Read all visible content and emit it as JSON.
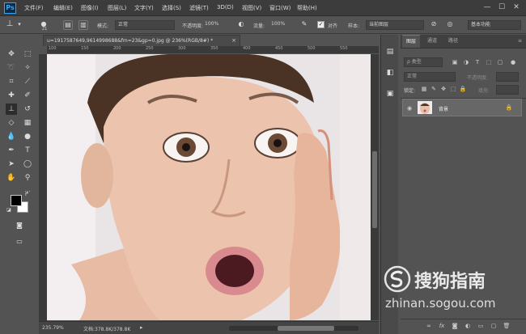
{
  "app": {
    "logo": "Ps"
  },
  "menu": [
    "文件(F)",
    "编辑(E)",
    "图像(I)",
    "图层(L)",
    "文字(Y)",
    "选择(S)",
    "滤镜(T)",
    "3D(D)",
    "视图(V)",
    "窗口(W)",
    "帮助(H)"
  ],
  "window_controls": {
    "minimize": "—",
    "maximize": "☐",
    "close": "✕"
  },
  "options": {
    "brush_size": "21",
    "mode_label": "模式:",
    "mode_value": "正常",
    "opacity_label": "不透明度:",
    "opacity_value": "100%",
    "flow_label": "流量:",
    "flow_value": "100%",
    "aligned_label": "对齐",
    "aligned_checked": true,
    "sample_label": "样本:",
    "sample_value": "当前图层",
    "workspace": "基本功能"
  },
  "document": {
    "tab_title": "u=1917587649,9614998688&fm=23&gp=0.jpg @ 236%(RGB/8#) *",
    "close": "×"
  },
  "rulers": {
    "top": [
      "100",
      "150",
      "200",
      "250",
      "300",
      "350",
      "400",
      "450",
      "500",
      "550"
    ]
  },
  "status": {
    "zoom": "235.79%",
    "doc_label": "文档:378.8K/378.8K"
  },
  "panel": {
    "tabs": [
      "图层",
      "通道",
      "路径"
    ],
    "filter_label": "ρ 类型",
    "blend_mode": "正常",
    "opacity_label": "不透明度:",
    "lock_label": "锁定:",
    "fill_label": "填充:",
    "layer_name": "背景"
  },
  "watermark": {
    "brand": "搜狗指南",
    "url": "zhinan.sogou.com"
  },
  "icons": {
    "tool_icons": [
      "move-icon",
      "marquee-icon",
      "lasso-icon",
      "magic-wand-icon",
      "crop-icon",
      "eyedropper-icon",
      "healing-icon",
      "brush-icon",
      "clone-stamp-icon",
      "history-brush-icon",
      "eraser-icon",
      "gradient-icon",
      "blur-icon",
      "dodge-icon",
      "pen-icon",
      "type-icon",
      "path-select-icon",
      "shape-icon",
      "hand-icon",
      "zoom-icon"
    ]
  },
  "colors": {
    "accent": "#31a8ff",
    "foreground": "#000000",
    "background": "#ffffff"
  }
}
